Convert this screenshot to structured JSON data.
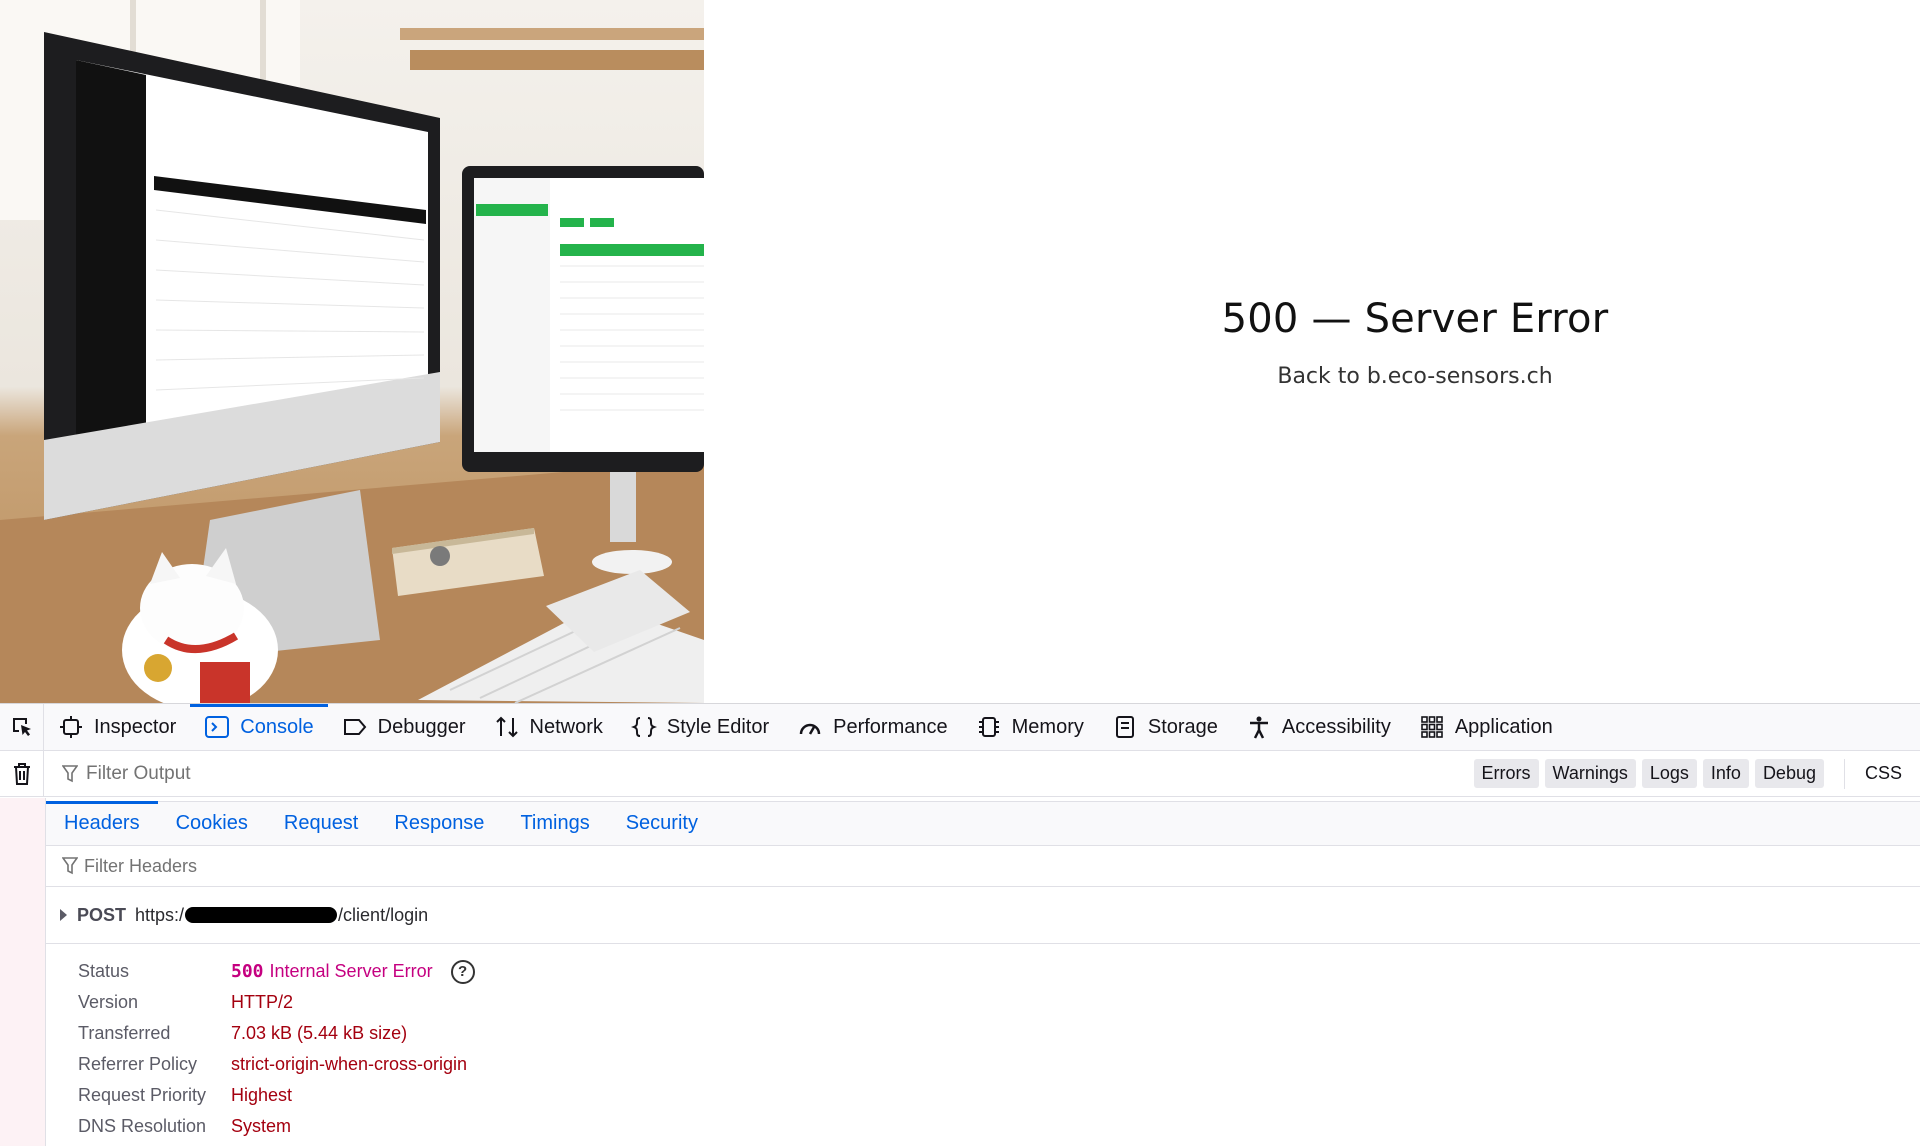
{
  "page": {
    "error_title": "500 — Server Error",
    "back_link": "Back to b.eco-sensors.ch"
  },
  "devtools": {
    "tabs": [
      {
        "label": "Inspector",
        "icon": "inspector-icon"
      },
      {
        "label": "Console",
        "icon": "console-icon",
        "active": true
      },
      {
        "label": "Debugger",
        "icon": "debugger-icon"
      },
      {
        "label": "Network",
        "icon": "network-icon"
      },
      {
        "label": "Style Editor",
        "icon": "style-editor-icon"
      },
      {
        "label": "Performance",
        "icon": "performance-icon"
      },
      {
        "label": "Memory",
        "icon": "memory-icon"
      },
      {
        "label": "Storage",
        "icon": "storage-icon"
      },
      {
        "label": "Accessibility",
        "icon": "accessibility-icon"
      },
      {
        "label": "Application",
        "icon": "application-icon"
      }
    ],
    "filter_placeholder": "Filter Output",
    "levels": [
      "Errors",
      "Warnings",
      "Logs",
      "Info",
      "Debug"
    ],
    "css_label": "CSS",
    "subtabs": [
      "Headers",
      "Cookies",
      "Request",
      "Response",
      "Timings",
      "Security"
    ],
    "header_filter_placeholder": "Filter Headers",
    "request": {
      "method": "POST",
      "url_prefix": "https:/",
      "url_suffix": "/client/login"
    },
    "details": {
      "status_label": "Status",
      "status_code": "500",
      "status_text": "Internal Server Error",
      "version_label": "Version",
      "version": "HTTP/2",
      "transferred_label": "Transferred",
      "transferred": "7.03 kB (5.44 kB size)",
      "referrer_label": "Referrer Policy",
      "referrer": "strict-origin-when-cross-origin",
      "priority_label": "Request Priority",
      "priority": "Highest",
      "dns_label": "DNS Resolution",
      "dns": "System"
    },
    "colors": {
      "accent": "#0061e0",
      "status": "#c50080",
      "value": "#a4000f"
    }
  }
}
